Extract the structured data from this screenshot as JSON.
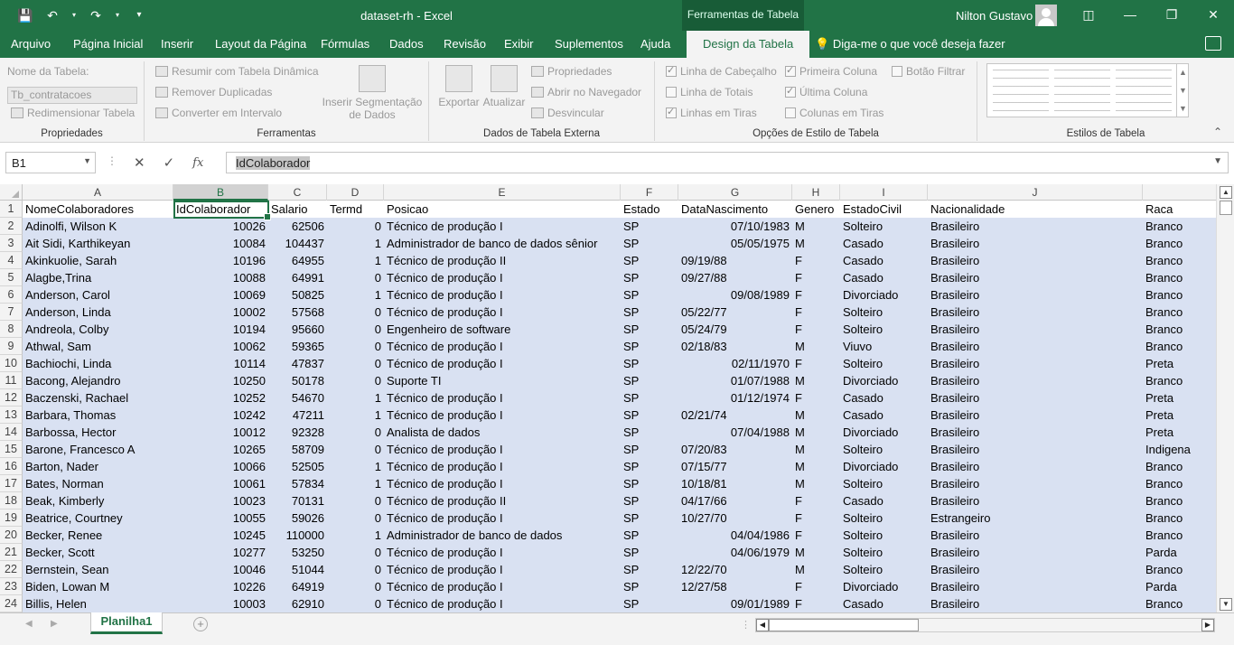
{
  "titlebar": {
    "doc_title": "dataset-rh  -  Excel",
    "context_tab": "Ferramentas de Tabela",
    "user": "Nilton Gustavo",
    "qat": {
      "save": "save-icon",
      "undo": "undo-icon",
      "redo": "redo-icon",
      "customize": "customize-icon"
    }
  },
  "tabs": [
    "Arquivo",
    "Página Inicial",
    "Inserir",
    "Layout da Página",
    "Fórmulas",
    "Dados",
    "Revisão",
    "Exibir",
    "Suplementos",
    "Ajuda",
    "Design da Tabela"
  ],
  "active_tab": "Design da Tabela",
  "tell_me": "Diga-me o que você deseja fazer",
  "ribbon": {
    "props": {
      "name_label": "Nome da Tabela:",
      "name_value": "Tb_contratacoes",
      "resize": "Redimensionar Tabela",
      "group": "Propriedades"
    },
    "tools": {
      "pivot": "Resumir com Tabela Dinâmica",
      "dupes": "Remover Duplicadas",
      "convert": "Converter em Intervalo",
      "slicer": "Inserir Segmentação de Dados",
      "group": "Ferramentas"
    },
    "external": {
      "export": "Exportar",
      "refresh": "Atualizar",
      "properties": "Propriedades",
      "open_browser": "Abrir no Navegador",
      "unlink": "Desvincular",
      "group": "Dados de Tabela Externa"
    },
    "style_options": {
      "header_row": "Linha de Cabeçalho",
      "total_row": "Linha de Totais",
      "banded_rows": "Linhas em Tiras",
      "first_column": "Primeira Coluna",
      "last_column": "Última Coluna",
      "banded_columns": "Colunas em Tiras",
      "filter_button": "Botão Filtrar",
      "group": "Opções de Estilo de Tabela"
    },
    "styles": {
      "group": "Estilos de Tabela"
    }
  },
  "formula": {
    "namebox": "B1",
    "content": "IdColaborador"
  },
  "columns": [
    {
      "letter": "A"
    },
    {
      "letter": "B",
      "selected": true
    },
    {
      "letter": "C"
    },
    {
      "letter": "D"
    },
    {
      "letter": "E"
    },
    {
      "letter": "F"
    },
    {
      "letter": "G"
    },
    {
      "letter": "H"
    },
    {
      "letter": "I"
    },
    {
      "letter": "J"
    }
  ],
  "header_row": [
    "NomeColaboradores",
    "IdColaborador",
    "Salario",
    "Termd",
    "Posicao",
    "Estado",
    "DataNascimento",
    "Genero",
    "EstadoCivil",
    "Nacionalidade",
    "Raca"
  ],
  "rows": [
    [
      "Adinolfi, Wilson  K",
      "10026",
      "62506",
      "0",
      "Técnico de produção I",
      "SP",
      "07/10/1983",
      "M",
      "Solteiro",
      "Brasileiro",
      "Branco"
    ],
    [
      "Ait Sidi, Karthikeyan",
      "10084",
      "104437",
      "1",
      "Administrador de banco de dados sênior",
      "SP",
      "05/05/1975",
      "M",
      "Casado",
      "Brasileiro",
      "Branco"
    ],
    [
      "Akinkuolie, Sarah",
      "10196",
      "64955",
      "1",
      "Técnico de produção II",
      "SP",
      "09/19/88",
      "F",
      "Casado",
      "Brasileiro",
      "Branco"
    ],
    [
      "Alagbe,Trina",
      "10088",
      "64991",
      "0",
      "Técnico de produção I",
      "SP",
      "09/27/88",
      "F",
      "Casado",
      "Brasileiro",
      "Branco"
    ],
    [
      "Anderson, Carol",
      "10069",
      "50825",
      "1",
      "Técnico de produção I",
      "SP",
      "09/08/1989",
      "F",
      "Divorciado",
      "Brasileiro",
      "Branco"
    ],
    [
      "Anderson, Linda",
      "10002",
      "57568",
      "0",
      "Técnico de produção I",
      "SP",
      "05/22/77",
      "F",
      "Solteiro",
      "Brasileiro",
      "Branco"
    ],
    [
      "Andreola, Colby",
      "10194",
      "95660",
      "0",
      "Engenheiro de software",
      "SP",
      "05/24/79",
      "F",
      "Solteiro",
      "Brasileiro",
      "Branco"
    ],
    [
      "Athwal, Sam",
      "10062",
      "59365",
      "0",
      "Técnico de produção I",
      "SP",
      "02/18/83",
      "M",
      "Viuvo",
      "Brasileiro",
      "Branco"
    ],
    [
      "Bachiochi, Linda",
      "10114",
      "47837",
      "0",
      "Técnico de produção I",
      "SP",
      "02/11/1970",
      "F",
      "Solteiro",
      "Brasileiro",
      "Preta"
    ],
    [
      "Bacong, Alejandro",
      "10250",
      "50178",
      "0",
      "Suporte TI",
      "SP",
      "01/07/1988",
      "M",
      "Divorciado",
      "Brasileiro",
      "Branco"
    ],
    [
      "Baczenski, Rachael",
      "10252",
      "54670",
      "1",
      "Técnico de produção I",
      "SP",
      "01/12/1974",
      "F",
      "Casado",
      "Brasileiro",
      "Preta"
    ],
    [
      "Barbara, Thomas",
      "10242",
      "47211",
      "1",
      "Técnico de produção I",
      "SP",
      "02/21/74",
      "M",
      "Casado",
      "Brasileiro",
      "Preta"
    ],
    [
      "Barbossa, Hector",
      "10012",
      "92328",
      "0",
      "Analista de dados",
      "SP",
      "07/04/1988",
      "M",
      "Divorciado",
      "Brasileiro",
      "Preta"
    ],
    [
      "Barone, Francesco  A",
      "10265",
      "58709",
      "0",
      "Técnico de produção I",
      "SP",
      "07/20/83",
      "M",
      "Solteiro",
      "Brasileiro",
      "Indigena"
    ],
    [
      "Barton, Nader",
      "10066",
      "52505",
      "1",
      "Técnico de produção I",
      "SP",
      "07/15/77",
      "M",
      "Divorciado",
      "Brasileiro",
      "Branco"
    ],
    [
      "Bates, Norman",
      "10061",
      "57834",
      "1",
      "Técnico de produção I",
      "SP",
      "10/18/81",
      "M",
      "Solteiro",
      "Brasileiro",
      "Branco"
    ],
    [
      "Beak, Kimberly",
      "10023",
      "70131",
      "0",
      "Técnico de produção II",
      "SP",
      "04/17/66",
      "F",
      "Casado",
      "Brasileiro",
      "Branco"
    ],
    [
      "Beatrice, Courtney",
      "10055",
      "59026",
      "0",
      "Técnico de produção I",
      "SP",
      "10/27/70",
      "F",
      "Solteiro",
      "Estrangeiro",
      "Branco"
    ],
    [
      "Becker, Renee",
      "10245",
      "110000",
      "1",
      "Administrador de banco de dados",
      "SP",
      "04/04/1986",
      "F",
      "Solteiro",
      "Brasileiro",
      "Branco"
    ],
    [
      "Becker, Scott",
      "10277",
      "53250",
      "0",
      "Técnico de produção I",
      "SP",
      "04/06/1979",
      "M",
      "Solteiro",
      "Brasileiro",
      "Parda"
    ],
    [
      "Bernstein, Sean",
      "10046",
      "51044",
      "0",
      "Técnico de produção I",
      "SP",
      "12/22/70",
      "M",
      "Solteiro",
      "Brasileiro",
      "Branco"
    ],
    [
      "Biden, Lowan  M",
      "10226",
      "64919",
      "0",
      "Técnico de produção I",
      "SP",
      "12/27/58",
      "F",
      "Divorciado",
      "Brasileiro",
      "Parda"
    ],
    [
      "Billis, Helen",
      "10003",
      "62910",
      "0",
      "Técnico de produção I",
      "SP",
      "09/01/1989",
      "F",
      "Casado",
      "Brasileiro",
      "Branco"
    ]
  ],
  "right_aligned_dates": [
    "07/10/1983",
    "05/05/1975",
    "09/08/1989",
    "02/11/1970",
    "01/07/1988",
    "01/12/1974",
    "07/04/1988",
    "04/04/1986",
    "04/06/1979",
    "09/01/1989"
  ],
  "sheet": {
    "tab": "Planilha1"
  },
  "colors": {
    "accent": "#217346",
    "band": "#d9e1f2"
  }
}
